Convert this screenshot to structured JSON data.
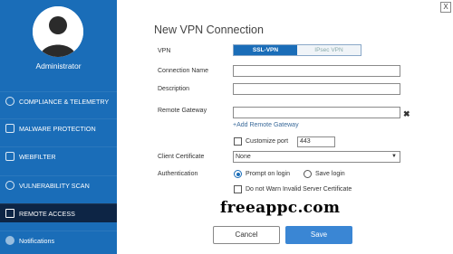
{
  "sidebar": {
    "user_name": "Administrator",
    "items": [
      {
        "label": "COMPLIANCE & TELEMETRY",
        "icon": "compliance-icon"
      },
      {
        "label": "MALWARE PROTECTION",
        "icon": "malware-shield-icon"
      },
      {
        "label": "WEBFILTER",
        "icon": "webfilter-icon"
      },
      {
        "label": "VULNERABILITY SCAN",
        "icon": "vulnerability-icon"
      },
      {
        "label": "REMOTE ACCESS",
        "icon": "remote-access-icon",
        "active": true
      },
      {
        "label": "Notifications",
        "icon": "notifications-icon"
      }
    ]
  },
  "window": {
    "close_label": "X"
  },
  "form": {
    "title": "New VPN Connection",
    "vpn_label": "VPN",
    "vpn_options": [
      "SSL-VPN",
      "IPsec VPN"
    ],
    "vpn_selected": "SSL-VPN",
    "connection_name_label": "Connection Name",
    "connection_name_value": "",
    "description_label": "Description",
    "description_value": "",
    "remote_gateway_label": "Remote Gateway",
    "remote_gateway_value": "",
    "add_gateway_label": "+Add Remote Gateway",
    "customize_port_label": "Customize port",
    "port_value": "443",
    "client_certificate_label": "Client Certificate",
    "client_certificate_value": "None",
    "authentication_label": "Authentication",
    "auth_options": [
      "Prompt on login",
      "Save login"
    ],
    "auth_selected": "Prompt on login",
    "invalid_cert_label": "Do not Warn Invalid Server Certificate",
    "cancel_label": "Cancel",
    "save_label": "Save"
  },
  "watermark": "freeappc.com",
  "colors": {
    "sidebar_bg": "#1a6db8",
    "sidebar_active": "#0d2545",
    "accent": "#1a6db8",
    "save_button": "#3a86d4"
  }
}
